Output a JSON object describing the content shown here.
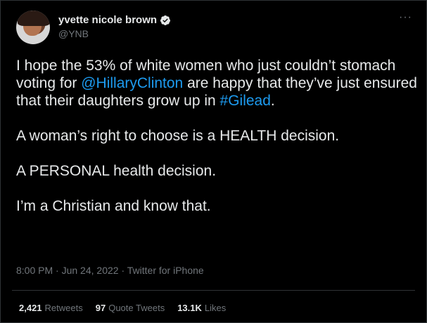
{
  "author": {
    "display_name": "yvette nicole brown",
    "handle": "@YNB"
  },
  "icons": {
    "verified": "verified-badge-icon",
    "more": "more-options-icon"
  },
  "tweet": {
    "paragraph1": {
      "part1": "I hope the 53% of white women who just couldn’t stomach voting for ",
      "mention": "@HillaryClinton",
      "part2": " are happy that they’ve just ensured that their daughters grow up in ",
      "hashtag": "#Gilead",
      "part3": "."
    },
    "paragraph2": "A woman’s right to choose is a HEALTH decision.",
    "paragraph3": "A PERSONAL health decision.",
    "paragraph4": "I’m a Christian and know that."
  },
  "meta": {
    "time": "8:00 PM",
    "date": "Jun 24, 2022",
    "source": "Twitter for iPhone",
    "separator": " · "
  },
  "stats": {
    "retweets_count": "2,421",
    "retweets_label": "Retweets",
    "quotes_count": "97",
    "quotes_label": "Quote Tweets",
    "likes_count": "13.1K",
    "likes_label": "Likes"
  },
  "colors": {
    "background": "#000000",
    "text": "#e7e9ea",
    "secondary": "#71767b",
    "link": "#1d9bf0",
    "border": "#2f3336"
  }
}
